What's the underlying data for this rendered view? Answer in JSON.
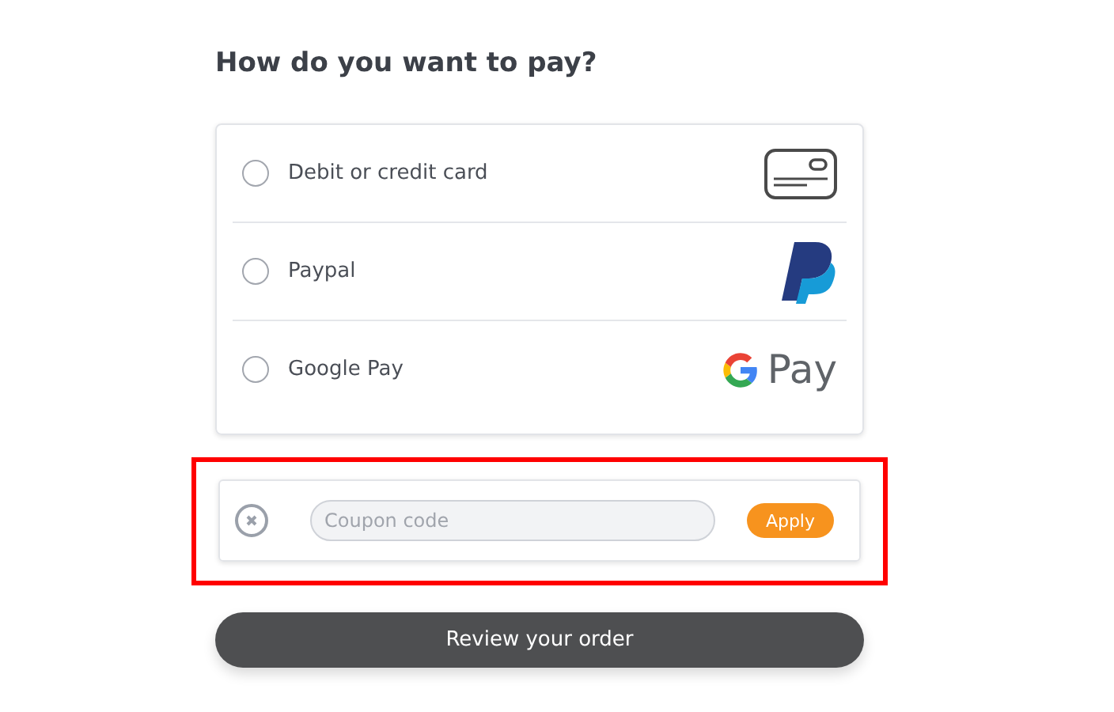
{
  "title": "How do you want to pay?",
  "methods": [
    {
      "label": "Debit or credit card",
      "kind": "card",
      "selected": false
    },
    {
      "label": "Paypal",
      "kind": "paypal",
      "selected": false
    },
    {
      "label": "Google Pay",
      "kind": "gpay",
      "logo_text": "Pay",
      "selected": false
    }
  ],
  "coupon": {
    "placeholder": "Coupon code",
    "apply": "Apply",
    "highlighted": true
  },
  "submit": "Review your order"
}
